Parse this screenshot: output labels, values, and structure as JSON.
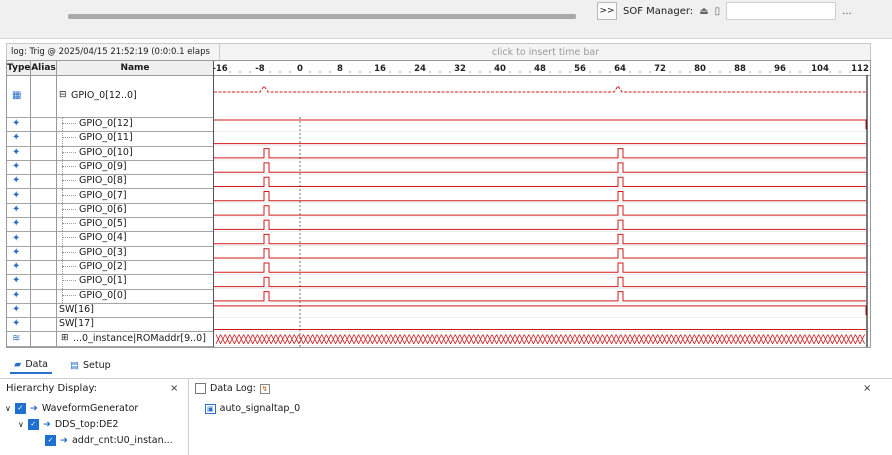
{
  "toolbar": {
    "sof_button": ">>",
    "sof_label": "SOF Manager:",
    "sof_icon1": "program-icon",
    "sof_icon2": "attach-icon",
    "sof_browse": "..."
  },
  "log_bar": {
    "log_text": "log: Trig @ 2025/04/15 21:52:19 (0:0:0.1 elaps",
    "time_bar_hint": "click to insert time bar"
  },
  "grid_header": {
    "type_col": "Type",
    "alias_col": "Alias",
    "name_col": "Name",
    "ticks": [
      "-16",
      "-8",
      "0",
      "8",
      "16",
      "24",
      "32",
      "40",
      "48",
      "56",
      "64",
      "72",
      "80",
      "88",
      "96",
      "104",
      "112"
    ]
  },
  "signals": [
    {
      "name": "GPIO_0[12..0]",
      "expand": "⊟",
      "kind": "bus-group"
    },
    {
      "name": "GPIO_0[12]",
      "kind": "bit",
      "pulse": false
    },
    {
      "name": "GPIO_0[11]",
      "kind": "bit",
      "pulse": false
    },
    {
      "name": "GPIO_0[10]",
      "kind": "bit",
      "pulse": true
    },
    {
      "name": "GPIO_0[9]",
      "kind": "bit",
      "pulse": true
    },
    {
      "name": "GPIO_0[8]",
      "kind": "bit",
      "pulse": true
    },
    {
      "name": "GPIO_0[7]",
      "kind": "bit",
      "pulse": true
    },
    {
      "name": "GPIO_0[6]",
      "kind": "bit",
      "pulse": true
    },
    {
      "name": "GPIO_0[5]",
      "kind": "bit",
      "pulse": true
    },
    {
      "name": "GPIO_0[4]",
      "kind": "bit",
      "pulse": true
    },
    {
      "name": "GPIO_0[3]",
      "kind": "bit",
      "pulse": true
    },
    {
      "name": "GPIO_0[2]",
      "kind": "bit",
      "pulse": true
    },
    {
      "name": "GPIO_0[1]",
      "kind": "bit",
      "pulse": true
    },
    {
      "name": "GPIO_0[0]",
      "kind": "bit",
      "pulse": true
    },
    {
      "name": "SW[16]",
      "kind": "high"
    },
    {
      "name": "SW[17]",
      "kind": "low"
    },
    {
      "name": "...0_instance|ROMaddr[9..0]",
      "expand": "⊞",
      "kind": "bus"
    }
  ],
  "tabs": [
    {
      "label": "Data",
      "icon": "data-icon",
      "active": true
    },
    {
      "label": "Setup",
      "icon": "setup-icon",
      "active": false
    }
  ],
  "hierarchy": {
    "title": "Hierarchy Display:",
    "close": "×",
    "items": [
      {
        "label": "WaveformGenerator",
        "level": 0
      },
      {
        "label": "DDS_top:DE2",
        "level": 1
      },
      {
        "label": "addr_cnt:U0_instan...",
        "level": 2
      }
    ]
  },
  "datalog": {
    "title": "Data Log:",
    "close": "×",
    "item": "auto_signaltap_0"
  },
  "colors": {
    "wave": "#d11a1a",
    "accent": "#2a6fc9"
  }
}
